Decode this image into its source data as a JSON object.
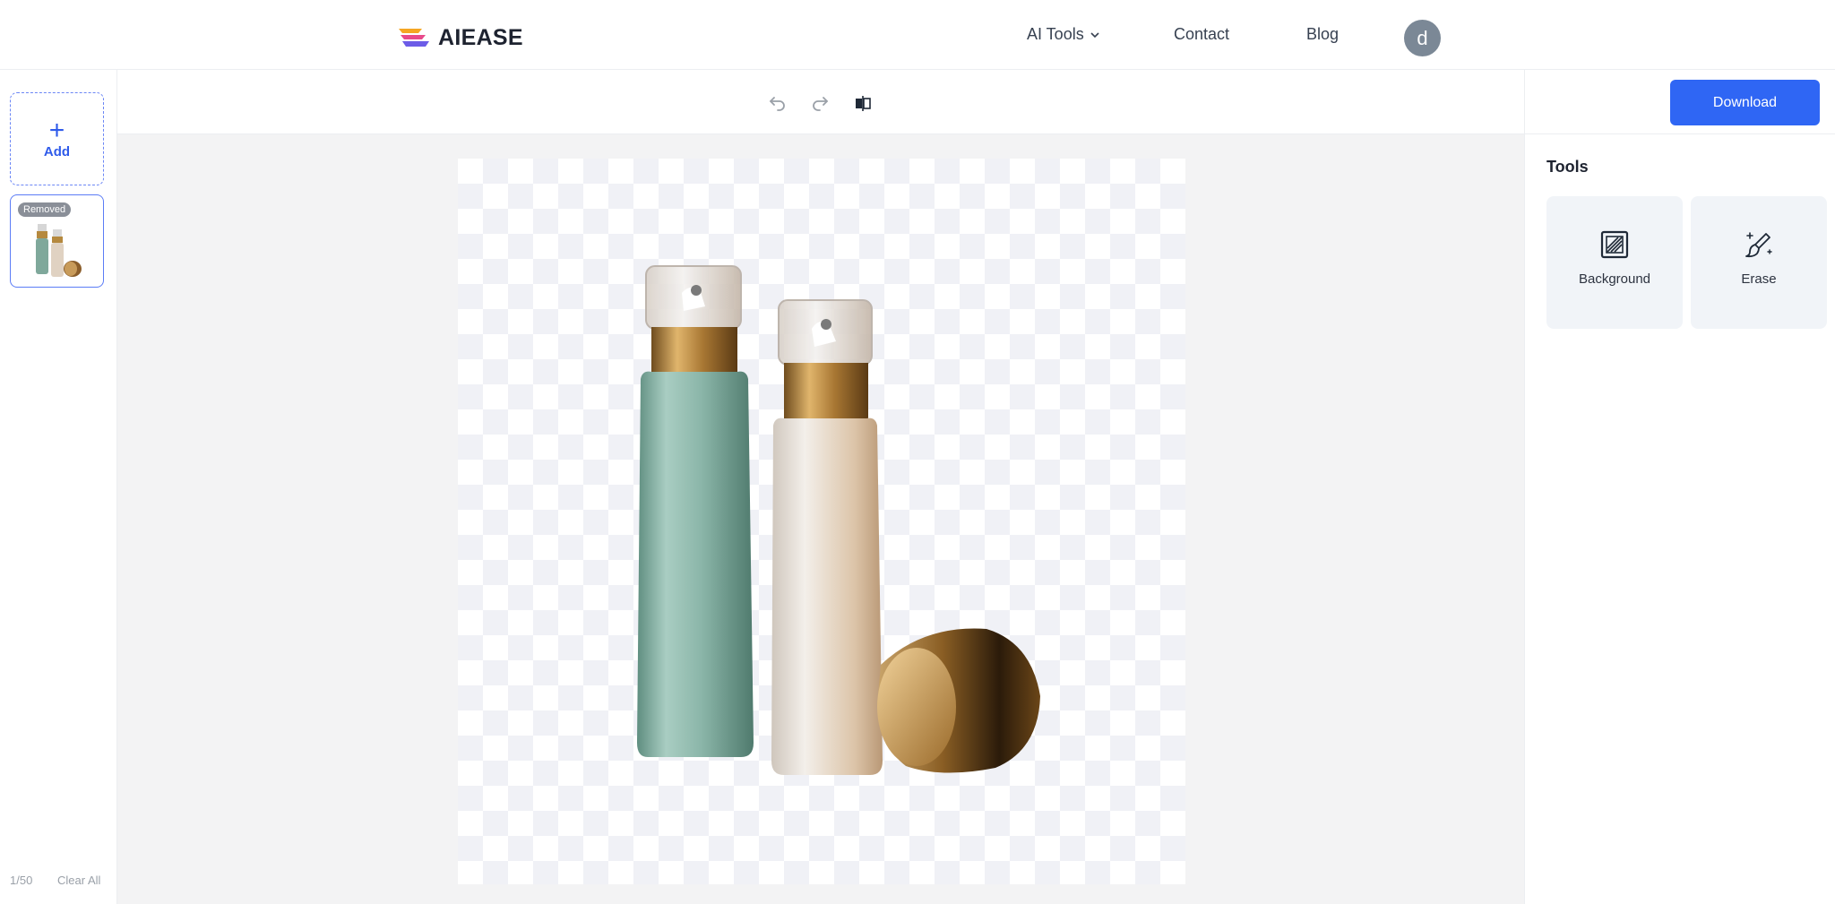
{
  "header": {
    "logo_text": "AIEASE",
    "nav": {
      "ai_tools": "AI Tools",
      "contact": "Contact",
      "blog": "Blog"
    },
    "avatar_initial": "d"
  },
  "left_rail": {
    "add_label": "Add",
    "thumb_badge": "Removed",
    "count": "1/50",
    "clear_all": "Clear All"
  },
  "toolbar": {
    "undo_icon": "undo-icon",
    "redo_icon": "redo-icon",
    "compare_icon": "compare-icon"
  },
  "right_panel": {
    "download_label": "Download",
    "tools_title": "Tools",
    "tools": [
      {
        "label": "Background",
        "icon": "background-pattern-icon"
      },
      {
        "label": "Erase",
        "icon": "erase-brush-icon"
      }
    ]
  },
  "colors": {
    "accent": "#2f66f4",
    "avatar": "#7b8896"
  }
}
